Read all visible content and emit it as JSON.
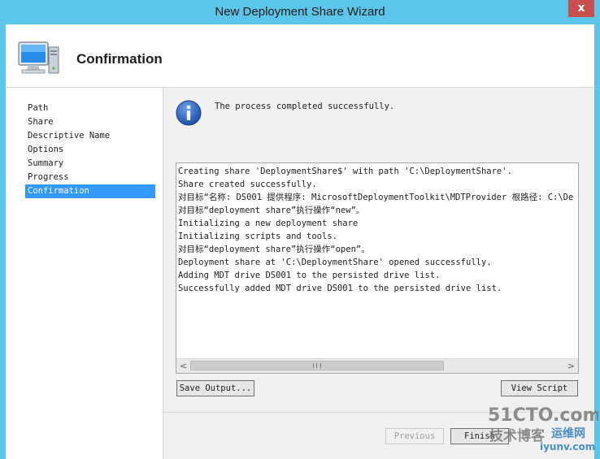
{
  "window": {
    "title": "New Deployment Share Wizard",
    "close_label": "x"
  },
  "header": {
    "title": "Confirmation"
  },
  "steps": [
    {
      "label": "Path",
      "active": false
    },
    {
      "label": "Share",
      "active": false
    },
    {
      "label": "Descriptive Name",
      "active": false
    },
    {
      "label": "Options",
      "active": false
    },
    {
      "label": "Summary",
      "active": false
    },
    {
      "label": "Progress",
      "active": false
    },
    {
      "label": "Confirmation",
      "active": true
    }
  ],
  "info": {
    "message": "The process completed successfully."
  },
  "log": {
    "lines": [
      "Creating share 'DeploymentShare$' with path 'C:\\DeploymentShare'.",
      "Share created successfully.",
      "对目标“名称: DS001 提供程序: MicrosoftDeploymentToolkit\\MDTProvider 根路径: C:\\De",
      "对目标“deployment share”执行操作“new”。",
      "Initializing a new deployment share",
      "Initializing scripts and tools.",
      "对目标“deployment share”执行操作“open”。",
      "Deployment share at 'C:\\DeploymentShare' opened successfully.",
      "Adding MDT drive DS001 to the persisted drive list.",
      "Successfully added MDT drive DS001 to the persisted drive list."
    ],
    "scroll_left_glyph": "<",
    "scroll_right_glyph": ">"
  },
  "buttons": {
    "save_output": "Save Output...",
    "view_script": "View Script",
    "previous": "Previous",
    "finish": "Finish"
  },
  "watermark": {
    "line1": "51CTO.com",
    "line2": "技术博客",
    "line3": "运维网",
    "line4": "iyunv.com"
  },
  "colors": {
    "title_bar": "#5bc6ea",
    "close_button": "#c7504f",
    "selection": "#3399ff"
  }
}
